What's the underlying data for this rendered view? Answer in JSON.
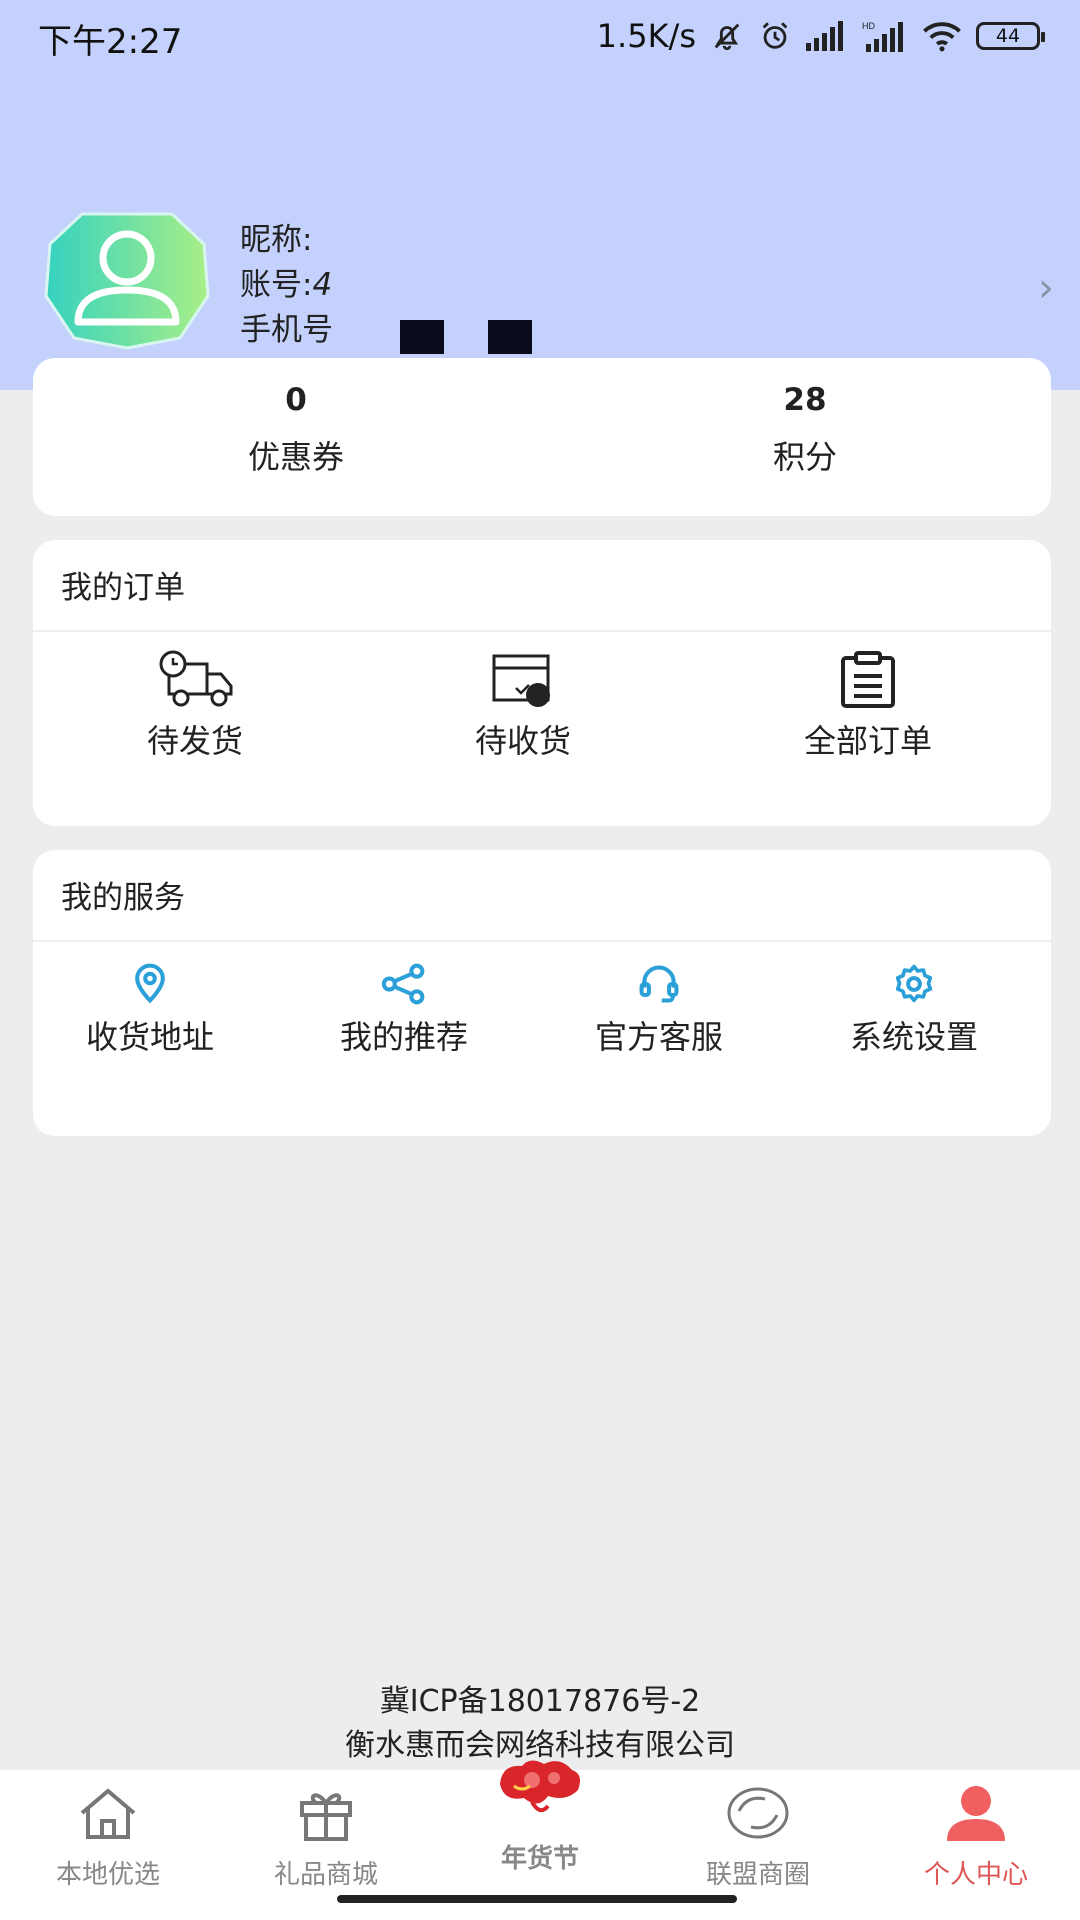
{
  "status_bar": {
    "time": "下午2:27",
    "speed": "1.5K/s",
    "battery": "44"
  },
  "profile": {
    "nickname_label": "昵称:",
    "account_label": "账号:",
    "account_value": "4",
    "phone_label": "手机号"
  },
  "stats": [
    {
      "value": "0",
      "label": "优惠券"
    },
    {
      "value": "28",
      "label": "积分"
    }
  ],
  "orders": {
    "title": "我的订单",
    "items": [
      {
        "label": "待发货",
        "icon": "delivery-truck-icon"
      },
      {
        "label": "待收货",
        "icon": "receive-box-icon"
      },
      {
        "label": "全部订单",
        "icon": "clipboard-icon"
      }
    ]
  },
  "services": {
    "title": "我的服务",
    "items": [
      {
        "label": "收货地址",
        "icon": "location-pin-icon"
      },
      {
        "label": "我的推荐",
        "icon": "share-icon"
      },
      {
        "label": "官方客服",
        "icon": "headset-icon"
      },
      {
        "label": "系统设置",
        "icon": "gear-icon"
      }
    ]
  },
  "footer": {
    "icp": "冀ICP备18017876号-2",
    "company": "衡水惠而会网络科技有限公司"
  },
  "tabbar": [
    {
      "label": "本地优选",
      "icon": "home-icon"
    },
    {
      "label": "礼品商城",
      "icon": "gift-icon"
    },
    {
      "label": "年货节",
      "icon": "festival-lantern-icon"
    },
    {
      "label": "联盟商圈",
      "icon": "circle-icon"
    },
    {
      "label": "个人中心",
      "icon": "person-icon",
      "active": true
    }
  ],
  "colors": {
    "header_bg": "#c3d1fc",
    "page_bg": "#ededed",
    "service_icon": "#2a9fd8",
    "active_tab": "#e05555",
    "festival": "#e12222"
  }
}
